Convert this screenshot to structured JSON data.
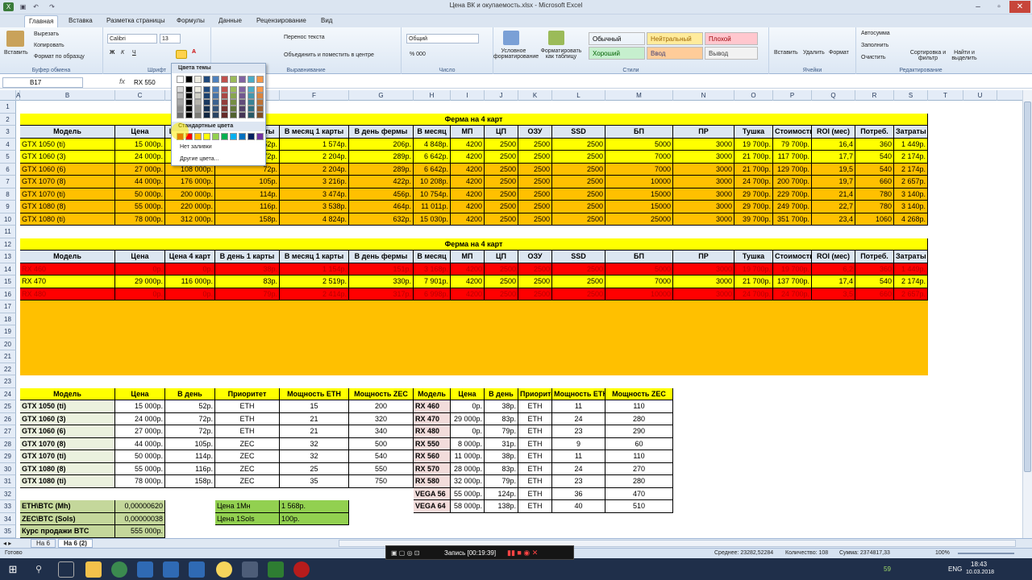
{
  "window": {
    "title": "Цена ВК и окупаемость.xlsx - Microsoft Excel"
  },
  "tabs": [
    "Главная",
    "Вставка",
    "Разметка страницы",
    "Формулы",
    "Данные",
    "Рецензирование",
    "Вид"
  ],
  "ribbon": {
    "paste": "Вставить",
    "cut": "Вырезать",
    "copy": "Копировать",
    "format_painter": "Формат по образцу",
    "clipboard": "Буфер обмена",
    "font_name": "Calibri",
    "font_size": "13",
    "font": "Шрифт",
    "wrap": "Перенос текста",
    "merge": "Объединить и поместить в центре",
    "alignment": "Выравнивание",
    "number_format": "Общий",
    "number": "Число",
    "cond_format": "Условное форматирование",
    "format_table": "Форматировать как таблицу",
    "styles_group": "Стили",
    "styles": [
      {
        "label": "Обычный",
        "bg": "#ffffff",
        "fg": "#000000"
      },
      {
        "label": "Нейтральный",
        "bg": "#ffeb9c",
        "fg": "#9c6500"
      },
      {
        "label": "Плохой",
        "bg": "#ffc7ce",
        "fg": "#9c0006"
      },
      {
        "label": "Хороший",
        "bg": "#c6efce",
        "fg": "#006100"
      },
      {
        "label": "Ввод",
        "bg": "#ffcc99",
        "fg": "#3f3f76"
      },
      {
        "label": "Вывод",
        "bg": "#f2f2f2",
        "fg": "#3f3f3f"
      }
    ],
    "insert": "Вставить",
    "delete": "Удалить",
    "format": "Формат",
    "cells": "Ячейки",
    "autosum": "Автосумма",
    "fill": "Заполнить",
    "clear": "Очистить",
    "sort": "Сортировка и фильтр",
    "find": "Найти и выделить",
    "editing": "Редактирование"
  },
  "palette": {
    "theme_title": "Цвета темы",
    "standard_title": "Стандартные цвета",
    "no_fill": "Нет заливки",
    "more_colors": "Другие цвета...",
    "theme_top": [
      "#ffffff",
      "#000000",
      "#eeece1",
      "#1f497d",
      "#4f81bd",
      "#c0504d",
      "#9bbb59",
      "#8064a2",
      "#4bacc6",
      "#f79646"
    ],
    "standard": [
      "#c00000",
      "#ff0000",
      "#ffc000",
      "#ffff00",
      "#92d050",
      "#00b050",
      "#00b0f0",
      "#0070c0",
      "#002060",
      "#7030a0"
    ]
  },
  "formula": {
    "name_box": "B17",
    "fx": "fx",
    "value": "RX 550"
  },
  "columns": [
    "A",
    "B",
    "C",
    "D",
    "E",
    "F",
    "G",
    "H",
    "I",
    "J",
    "K",
    "L",
    "M",
    "N",
    "O",
    "P",
    "Q",
    "R",
    "S",
    "T",
    "U"
  ],
  "rows": [
    "1",
    "2",
    "3",
    "4",
    "5",
    "6",
    "7",
    "8",
    "9",
    "10",
    "11",
    "12",
    "13",
    "14",
    "15",
    "16",
    "17",
    "18",
    "19",
    "20",
    "21",
    "22",
    "23",
    "24",
    "25",
    "26",
    "27",
    "28",
    "29",
    "30",
    "31",
    "32",
    "33",
    "34",
    "35"
  ],
  "farm_title": "Ферма на 4 карт",
  "headers": [
    "Модель",
    "Цена",
    "Цена 4 карт",
    "В день 1 карты",
    "В месяц 1 карты",
    "В день фермы",
    "В месяц",
    "МП",
    "ЦП",
    "ОЗУ",
    "SSD",
    "БП",
    "ПР",
    "Тушка",
    "Стоимость",
    "ROI (мес)",
    "Потреб.",
    "Затраты"
  ],
  "nvidia_rows": [
    {
      "c": [
        "GTX 1050 (ti)",
        "15 000р.",
        "60 000р.",
        "52р.",
        "1 574р.",
        "206р.",
        "4 848р.",
        "4200",
        "2500",
        "2500",
        "2500",
        "5000",
        "3000",
        "19 700р.",
        "79 700р.",
        "16,4",
        "360",
        "1 449р."
      ],
      "fill": "#ffff00"
    },
    {
      "c": [
        "GTX 1060 (3)",
        "24 000р.",
        "96 000р.",
        "72р.",
        "2 204р.",
        "289р.",
        "6 642р.",
        "4200",
        "2500",
        "2500",
        "2500",
        "7000",
        "3000",
        "21 700р.",
        "117 700р.",
        "17,7",
        "540",
        "2 174р."
      ],
      "fill": "#ffff00"
    },
    {
      "c": [
        "GTX 1060 (6)",
        "27 000р.",
        "108 000р.",
        "72р.",
        "2 204р.",
        "289р.",
        "6 642р.",
        "4200",
        "2500",
        "2500",
        "2500",
        "7000",
        "3000",
        "21 700р.",
        "129 700р.",
        "19,5",
        "540",
        "2 174р."
      ],
      "fill": "#ffc000"
    },
    {
      "c": [
        "GTX 1070 (8)",
        "44 000р.",
        "176 000р.",
        "105р.",
        "3 216р.",
        "422р.",
        "10 208р.",
        "4200",
        "2500",
        "2500",
        "2500",
        "10000",
        "3000",
        "24 700р.",
        "200 700р.",
        "19,7",
        "660",
        "2 657р."
      ],
      "fill": "#ffc000"
    },
    {
      "c": [
        "GTX 1070 (ti)",
        "50 000р.",
        "200 000р.",
        "114р.",
        "3 474р.",
        "456р.",
        "10 754р.",
        "4200",
        "2500",
        "2500",
        "2500",
        "15000",
        "3000",
        "29 700р.",
        "229 700р.",
        "21,4",
        "780",
        "3 140р."
      ],
      "fill": "#ffc000"
    },
    {
      "c": [
        "GTX 1080 (8)",
        "55 000р.",
        "220 000р.",
        "116р.",
        "3 538р.",
        "464р.",
        "11 011р.",
        "4200",
        "2500",
        "2500",
        "2500",
        "15000",
        "3000",
        "29 700р.",
        "249 700р.",
        "22,7",
        "780",
        "3 140р."
      ],
      "fill": "#ffc000"
    },
    {
      "c": [
        "GTX 1080 (ti)",
        "78 000р.",
        "312 000р.",
        "158р.",
        "4 824р.",
        "632р.",
        "15 030р.",
        "4200",
        "2500",
        "2500",
        "2500",
        "25000",
        "3000",
        "39 700р.",
        "351 700р.",
        "23,4",
        "1060",
        "4 268р."
      ],
      "fill": "#ffc000"
    }
  ],
  "amd_rows": [
    {
      "c": [
        "RX 460",
        "0р.",
        "0р.",
        "38р.",
        "1 154р.",
        "151р.",
        "3 168р.",
        "4200",
        "2500",
        "2500",
        "2500",
        "5000",
        "3000",
        "19 700р.",
        "19 700р.",
        "6,2",
        "360",
        "1 449р."
      ],
      "fill": "#ff0000"
    },
    {
      "c": [
        "RX 470",
        "29 000р.",
        "116 000р.",
        "83р.",
        "2 519р.",
        "330р.",
        "7 901р.",
        "4200",
        "2500",
        "2500",
        "2500",
        "7000",
        "3000",
        "21 700р.",
        "137 700р.",
        "17,4",
        "540",
        "2 174р."
      ],
      "fill": "#ffff00"
    },
    {
      "c": [
        "RX 480",
        "0р.",
        "0р.",
        "79р.",
        "2 414р.",
        "317р.",
        "6 998р.",
        "4200",
        "2500",
        "2500",
        "2500",
        "10000",
        "3000",
        "24 700р.",
        "24 700р.",
        "3,5",
        "660",
        "2 657р."
      ],
      "fill": "#ff0000"
    }
  ],
  "lower_left_headers": [
    "Модель",
    "Цена",
    "В день",
    "Приоритет",
    "Мощность ETH",
    "Мощность ZEC"
  ],
  "lower_left": [
    [
      "GTX 1050 (ti)",
      "15 000р.",
      "52р.",
      "ETH",
      "15",
      "200"
    ],
    [
      "GTX 1060 (3)",
      "24 000р.",
      "72р.",
      "ETH",
      "21",
      "320"
    ],
    [
      "GTX 1060 (6)",
      "27 000р.",
      "72р.",
      "ETH",
      "21",
      "340"
    ],
    [
      "GTX 1070 (8)",
      "44 000р.",
      "105р.",
      "ZEC",
      "32",
      "500"
    ],
    [
      "GTX 1070 (ti)",
      "50 000р.",
      "114р.",
      "ZEC",
      "32",
      "540"
    ],
    [
      "GTX 1080 (8)",
      "55 000р.",
      "116р.",
      "ZEC",
      "25",
      "550"
    ],
    [
      "GTX 1080 (ti)",
      "78 000р.",
      "158р.",
      "ZEC",
      "35",
      "750"
    ]
  ],
  "lower_right_headers": [
    "Модель",
    "Цена",
    "В день",
    "Приоритет",
    "Мощность ETH",
    "Мощность ZEC"
  ],
  "lower_right": [
    [
      "RX 460",
      "0р.",
      "38р.",
      "ETH",
      "11",
      "110"
    ],
    [
      "RX 470",
      "29 000р.",
      "83р.",
      "ETH",
      "24",
      "280"
    ],
    [
      "RX 480",
      "0р.",
      "79р.",
      "ETH",
      "23",
      "290"
    ],
    [
      "RX 550",
      "8 000р.",
      "31р.",
      "ETH",
      "9",
      "60"
    ],
    [
      "RX 560",
      "11 000р.",
      "38р.",
      "ETH",
      "11",
      "110"
    ],
    [
      "RX 570",
      "28 000р.",
      "83р.",
      "ETH",
      "24",
      "270"
    ],
    [
      "RX 580",
      "32 000р.",
      "79р.",
      "ETH",
      "23",
      "280"
    ],
    [
      "VEGA 56",
      "55 000р.",
      "124р.",
      "ETH",
      "36",
      "470"
    ],
    [
      "VEGA 64",
      "58 000р.",
      "138р.",
      "ETH",
      "40",
      "510"
    ]
  ],
  "rates": [
    [
      "ETH\\BTC (Mh)",
      "0,00000620"
    ],
    [
      "ZEC\\BTC (Sols)",
      "0,00000038"
    ],
    [
      "Курс продажи BTC",
      "555 000р."
    ]
  ],
  "prices": [
    [
      "Цена 1Мн",
      "1 568р."
    ],
    [
      "Цена 1Sols",
      "100р."
    ]
  ],
  "sheets": [
    "На 6",
    "На 6 (2)"
  ],
  "status": {
    "ready": "Готово",
    "avg": "Среднее: 23282,52284",
    "count": "Количество: 108",
    "sum": "Сумма: 2374817,33",
    "zoom": "100%"
  },
  "recording": {
    "label": "Запись [00:19:39]"
  },
  "taskbar": {
    "clock": "18:43",
    "date": "10.03.2018",
    "lang": "ENG",
    "temp": "59"
  }
}
